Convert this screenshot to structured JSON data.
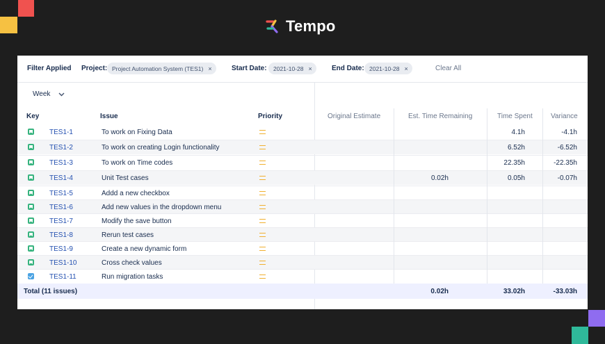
{
  "brand": {
    "name": "Tempo",
    "colors": {
      "red": "#f0524f",
      "yellow": "#f6c142",
      "purple": "#8f6cf0",
      "green": "#2fb99a",
      "background": "#1e1e1e"
    }
  },
  "filters": {
    "title": "Filter Applied",
    "project_label": "Project:",
    "project_value": "Project Automation System (TES1)",
    "start_label": "Start Date:",
    "start_value": "2021-10-28",
    "end_label": "End Date:",
    "end_value": "2021-10-28",
    "remove_glyph": "×",
    "clear_all": "Clear All"
  },
  "period": {
    "selected": "Week",
    "chevron_icon": "chevron-down-icon"
  },
  "columns": {
    "key": "Key",
    "issue": "Issue",
    "priority": "Priority",
    "original_estimate": "Original Estimate",
    "remaining": "Est. Time Remaining",
    "spent": "Time Spent",
    "variance": "Variance"
  },
  "rows": [
    {
      "type": "story",
      "key": "TES1-1",
      "issue": "To work on Fixing Data",
      "priority": "medium",
      "estimate": "",
      "remaining": "",
      "spent": "4.1h",
      "variance": "-4.1h"
    },
    {
      "type": "story",
      "key": "TES1-2",
      "issue": "To work on creating Login functionality",
      "priority": "medium",
      "estimate": "",
      "remaining": "",
      "spent": "6.52h",
      "variance": "-6.52h"
    },
    {
      "type": "story",
      "key": "TES1-3",
      "issue": "To work on Time codes",
      "priority": "medium",
      "estimate": "",
      "remaining": "",
      "spent": "22.35h",
      "variance": "-22.35h"
    },
    {
      "type": "story",
      "key": "TES1-4",
      "issue": "Unit Test cases",
      "priority": "medium",
      "estimate": "",
      "remaining": "0.02h",
      "spent": "0.05h",
      "variance": "-0.07h"
    },
    {
      "type": "story",
      "key": "TES1-5",
      "issue": "Addd a new checkbox",
      "priority": "medium",
      "estimate": "",
      "remaining": "",
      "spent": "",
      "variance": ""
    },
    {
      "type": "story",
      "key": "TES1-6",
      "issue": "Add new values in the dropdown menu",
      "priority": "medium",
      "estimate": "",
      "remaining": "",
      "spent": "",
      "variance": ""
    },
    {
      "type": "story",
      "key": "TES1-7",
      "issue": "Modify the save button",
      "priority": "medium",
      "estimate": "",
      "remaining": "",
      "spent": "",
      "variance": ""
    },
    {
      "type": "story",
      "key": "TES1-8",
      "issue": "Rerun test cases",
      "priority": "medium",
      "estimate": "",
      "remaining": "",
      "spent": "",
      "variance": ""
    },
    {
      "type": "story",
      "key": "TES1-9",
      "issue": "Create a new dynamic form",
      "priority": "medium",
      "estimate": "",
      "remaining": "",
      "spent": "",
      "variance": ""
    },
    {
      "type": "story",
      "key": "TES1-10",
      "issue": "Cross check values",
      "priority": "medium",
      "estimate": "",
      "remaining": "",
      "spent": "",
      "variance": ""
    },
    {
      "type": "task",
      "key": "TES1-11",
      "issue": "Run migration tasks",
      "priority": "medium",
      "estimate": "",
      "remaining": "",
      "spent": "",
      "variance": ""
    }
  ],
  "total": {
    "label": "Total (11 issues)",
    "remaining": "0.02h",
    "spent": "33.02h",
    "variance": "-33.03h"
  }
}
